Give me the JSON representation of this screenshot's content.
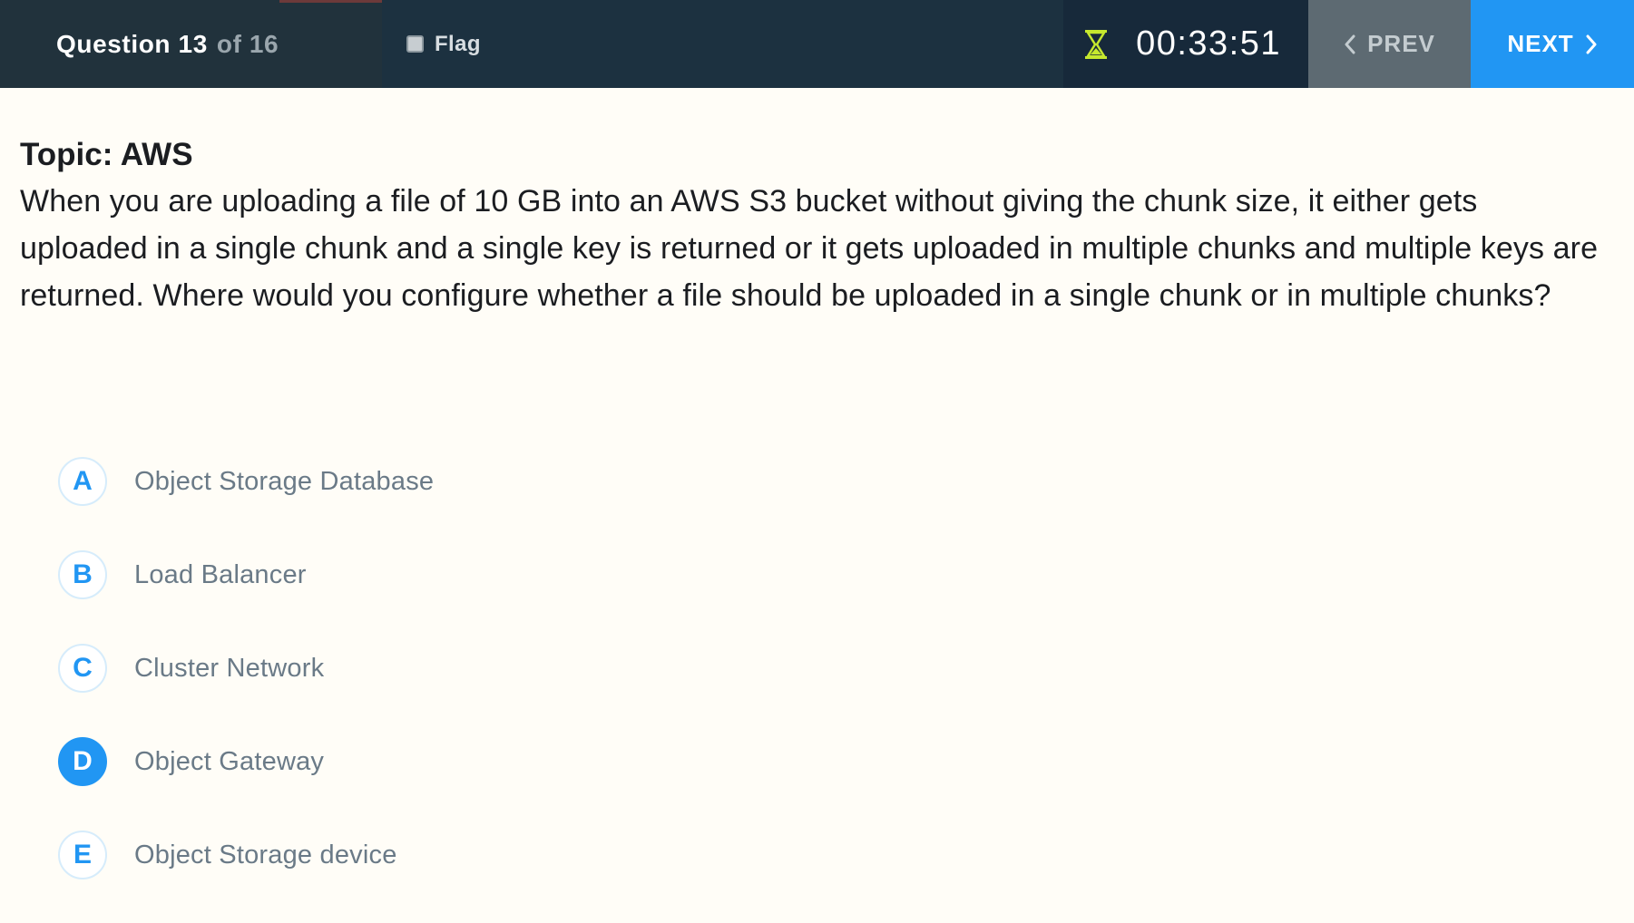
{
  "header": {
    "question_label": "Question 13",
    "question_total": "of 16",
    "flag_label": "Flag",
    "flag_checked": false,
    "timer_icon": "hourglass-icon",
    "timer_value": "00:33:51",
    "prev_label": "PREV",
    "next_label": "NEXT"
  },
  "question": {
    "topic": "Topic: AWS",
    "text": "When you are uploading a file of 10 GB into an AWS S3 bucket without giving the chunk size, it either gets uploaded in a single chunk and a single key is returned or it gets uploaded in multiple chunks and multiple keys are returned. Where would you configure whether a file should be uploaded in a single chunk or in multiple chunks?"
  },
  "options": [
    {
      "letter": "A",
      "text": "Object Storage Database",
      "selected": false
    },
    {
      "letter": "B",
      "text": "Load Balancer",
      "selected": false
    },
    {
      "letter": "C",
      "text": "Cluster Network",
      "selected": false
    },
    {
      "letter": "D",
      "text": "Object Gateway",
      "selected": true
    },
    {
      "letter": "E",
      "text": "Object Storage device",
      "selected": false
    }
  ],
  "colors": {
    "accent": "#2196f3",
    "topbar": "#1c3140",
    "timer_icon": "#c6e82e",
    "background": "#fffdf7"
  }
}
